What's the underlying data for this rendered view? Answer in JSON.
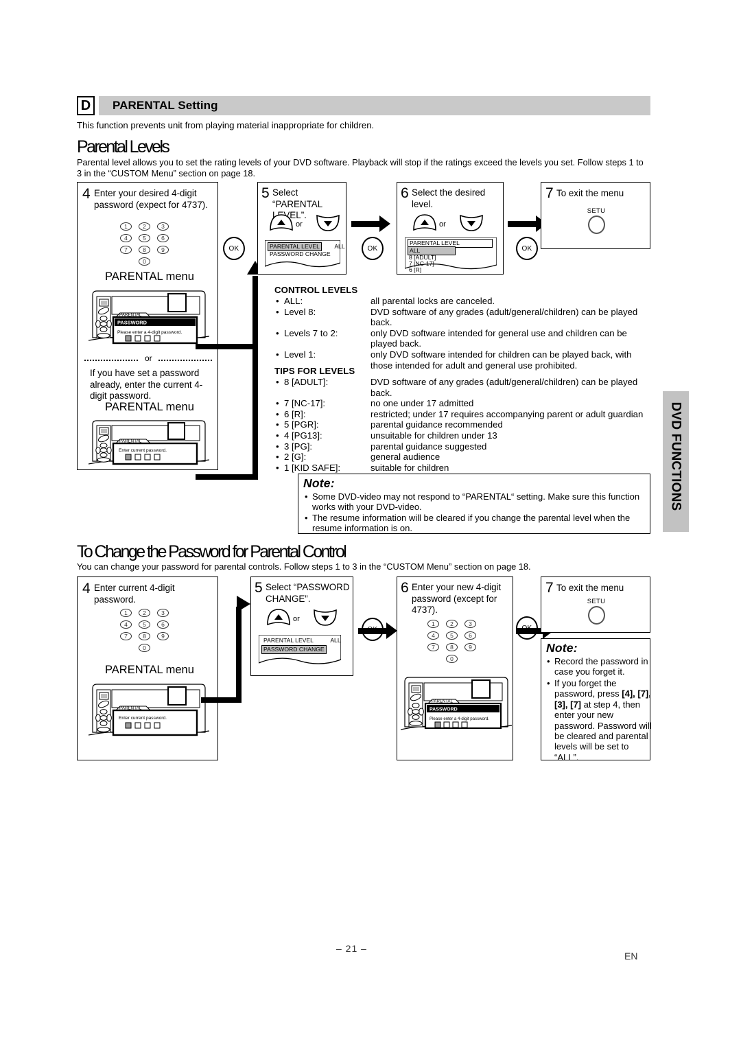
{
  "section": {
    "letter": "D",
    "title": "PARENTAL Setting",
    "intro": "This function prevents unit from playing material inappropriate for children."
  },
  "parental_levels": {
    "heading": "Parental Levels",
    "description": "Parental level allows you to set the rating levels of your DVD software. Playback will stop if the ratings exceed the levels you set. Follow steps 1 to 3 in the “CUSTOM Menu” section on page 18.",
    "steps": [
      {
        "num": "4",
        "text": "Enter your desired 4-digit password (expect for 4737).",
        "keys": [
          "1",
          "2",
          "3",
          "4",
          "5",
          "6",
          "7",
          "8",
          "9",
          "0"
        ],
        "menu_label": "PARENTAL menu",
        "osd_tab": "PARENTAL",
        "osd_title": "PASSWORD",
        "osd_prompt": "Please  enter  a  4-digit  password."
      },
      {
        "or_label": "or",
        "alt_text": "If you have set a password already, enter the current 4-digit password.",
        "menu_label": "PARENTAL menu",
        "osd_tab": "PARENTAL",
        "osd_prompt": "Enter  current  password."
      },
      {
        "num": "5",
        "text": "Select “PARENTAL LEVEL”.",
        "or_label": "or",
        "osd_rows": [
          {
            "label": "PARENTAL LEVEL",
            "highlight": true,
            "value": "ALL"
          },
          {
            "label": "PASSWORD CHANGE",
            "highlight": false,
            "value": ""
          }
        ]
      },
      {
        "num": "6",
        "text": "Select the desired level.",
        "or_label": "or",
        "osd_rows": [
          {
            "label": "PARENTAL LEVEL",
            "highlight": false,
            "boxed": true
          },
          {
            "label": "ALL",
            "highlight": true
          },
          {
            "label": "8 [ADULT]",
            "highlight": false
          },
          {
            "label": "7 [NC-17]",
            "highlight": false
          },
          {
            "label": "6 [R]",
            "highlight": false
          }
        ]
      },
      {
        "num": "7",
        "text": "To exit the menu",
        "button_label": "SETU"
      }
    ],
    "ok_label": "OK"
  },
  "control_levels": {
    "heading": "CONTROL LEVELS",
    "rows": [
      {
        "term": "ALL:",
        "desc": "all parental locks are canceled."
      },
      {
        "term": "Level 8:",
        "desc": "DVD software of any grades (adult/general/children) can be played back."
      },
      {
        "term": "Levels 7 to 2:",
        "desc": "only DVD software intended for general use and children can be played back."
      },
      {
        "term": "Level 1:",
        "desc": "only DVD software intended for children can be played back, with those intended for adult and general use prohibited."
      }
    ]
  },
  "tips_for_levels": {
    "heading": "TIPS FOR LEVELS",
    "rows": [
      {
        "term": "8 [ADULT]:",
        "desc": "DVD software of any grades (adult/general/children) can be played back."
      },
      {
        "term": "7 [NC-17]:",
        "desc": "no one under 17 admitted"
      },
      {
        "term": "6 [R]:",
        "desc": "restricted; under 17 requires accompanying parent or adult guardian"
      },
      {
        "term": "5 [PGR]:",
        "desc": "parental guidance recommended"
      },
      {
        "term": "4 [PG13]:",
        "desc": "unsuitable for children under 13"
      },
      {
        "term": "3 [PG]:",
        "desc": "parental guidance suggested"
      },
      {
        "term": "2 [G]:",
        "desc": "general audience"
      },
      {
        "term": "1 [KID SAFE]:",
        "desc": "suitable for children"
      }
    ]
  },
  "note_top": {
    "title": "Note:",
    "items": [
      "Some DVD-video may not respond to “PARENTAL“ setting. Make sure this function works with your DVD-video.",
      "The resume information will be cleared if you change the parental level when the resume information is on."
    ]
  },
  "change_password": {
    "heading": "To Change the Password for Parental Control",
    "description": "You can change your password for parental controls.  Follow steps 1 to 3 in the “CUSTOM Menu” section on page 18.",
    "steps": [
      {
        "num": "4",
        "text": "Enter current 4-digit password.",
        "keys": [
          "1",
          "2",
          "3",
          "4",
          "5",
          "6",
          "7",
          "8",
          "9",
          "0"
        ],
        "menu_label": "PARENTAL menu",
        "osd_tab": "PARENTAL",
        "osd_prompt": "Enter  current  password."
      },
      {
        "num": "5",
        "text": "Select “PASSWORD CHANGE”.",
        "or_label": "or",
        "osd_rows": [
          {
            "label": "PARENTAL LEVEL",
            "highlight": false,
            "value": "ALL"
          },
          {
            "label": "PASSWORD CHANGE",
            "highlight": true,
            "value": ""
          }
        ]
      },
      {
        "num": "6",
        "text": "Enter your new 4-digit password (except for 4737).",
        "keys": [
          "1",
          "2",
          "3",
          "4",
          "5",
          "6",
          "7",
          "8",
          "9",
          "0"
        ],
        "osd_tab": "PARENTAL",
        "osd_title": "PASSWORD",
        "osd_prompt": "Please  enter  a  4-digit  password."
      },
      {
        "num": "7",
        "text": "To exit the menu",
        "button_label": "SETU"
      }
    ],
    "ok_label": "OK"
  },
  "note_bottom": {
    "title": "Note:",
    "items": [
      "Record the password in case you forget it.",
      "If you forget the password, press [4], [7], [3], [7] at step 4, then enter your new password. Password will be cleared and parental levels will be set to “ALL”."
    ],
    "item2_parts": {
      "a": "If you forget the password, press ",
      "b": "[4], [7], [3], [7]",
      "c": " at step 4, then enter your new password. Password will be cleared and parental levels will be set to “ALL”."
    }
  },
  "side_tab": {
    "label": "DVD FUNCTIONS"
  },
  "footer": {
    "page": "– 21 –",
    "lang": "EN"
  }
}
